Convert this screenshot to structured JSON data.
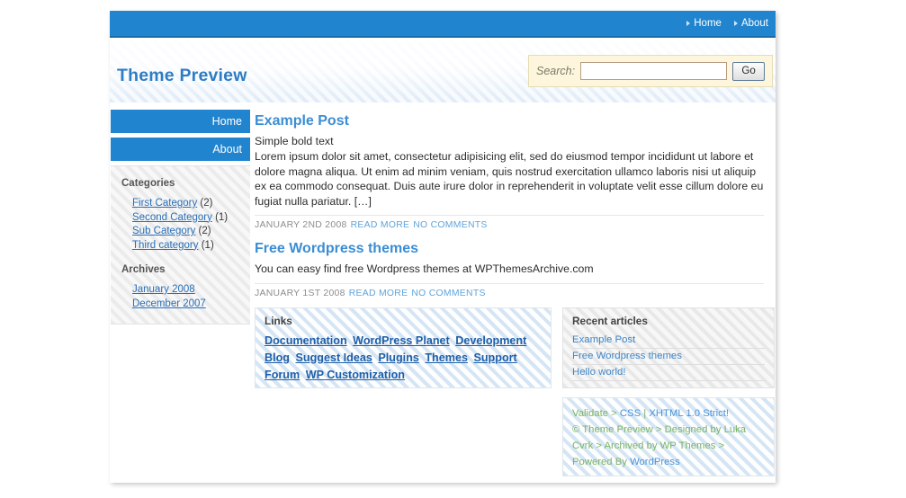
{
  "topnav": {
    "items": [
      {
        "label": "Home"
      },
      {
        "label": "About"
      }
    ]
  },
  "masthead": {
    "site_title": "Theme Preview"
  },
  "search": {
    "label": "Search:",
    "value": "",
    "placeholder": "",
    "button_label": "Go"
  },
  "sidebar": {
    "nav": [
      {
        "label": "Home"
      },
      {
        "label": "About"
      }
    ],
    "categories": {
      "title": "Categories",
      "items": [
        {
          "label": "First Category",
          "count": "(2)"
        },
        {
          "label": "Second Category",
          "count": "(1)"
        },
        {
          "label": "Sub Category",
          "count": "(2)"
        },
        {
          "label": "Third category",
          "count": "(1)"
        }
      ]
    },
    "archives": {
      "title": "Archives",
      "items": [
        {
          "label": "January 2008"
        },
        {
          "label": "December 2007"
        }
      ]
    }
  },
  "posts": [
    {
      "title": "Example Post",
      "lead": "Simple bold text",
      "body": "Lorem ipsum dolor sit amet, consectetur adipisicing elit, sed do eiusmod tempor incididunt ut labore et dolore magna aliqua. Ut enim ad minim veniam, quis nostrud exercitation ullamco laboris nisi ut aliquip ex ea commodo consequat. Duis aute irure dolor in reprehenderit in voluptate velit esse cillum dolore eu fugiat nulla pariatur. […]",
      "date": "JANUARY 2ND 2008",
      "read_more": "READ MORE",
      "comments": "NO COMMENTS"
    },
    {
      "title": "Free Wordpress themes",
      "lead": "",
      "body": "You can easy find free Wordpress themes at WPThemesArchive.com",
      "date": "JANUARY 1ST 2008",
      "read_more": "READ MORE",
      "comments": "NO COMMENTS"
    }
  ],
  "links": {
    "title": "Links",
    "items": [
      {
        "label": "Documentation"
      },
      {
        "label": "WordPress Planet"
      },
      {
        "label": "Development Blog"
      },
      {
        "label": "Suggest Ideas"
      },
      {
        "label": "Plugins"
      },
      {
        "label": "Themes"
      },
      {
        "label": "Support Forum"
      },
      {
        "label": "WP Customization"
      }
    ]
  },
  "recent": {
    "title": "Recent articles",
    "items": [
      {
        "label": "Example Post"
      },
      {
        "label": "Free Wordpress themes"
      },
      {
        "label": "Hello world!"
      }
    ]
  },
  "credits": {
    "validate_label": "Validate",
    "sep1": ">",
    "css_link": "CSS",
    "pipe": "|",
    "xhtml_link": "XHTML 1.0 Strict!",
    "copyright": "© Theme Preview",
    "sep2": ">",
    "designed_by": "Designed by Luka Cvrk",
    "sep3": ">",
    "archived_by": "Archived by WP Themes",
    "sep4": ">",
    "powered_by": "Powered By",
    "wordpress": "WordPress"
  },
  "colors": {
    "brand_blue": "#2184ce",
    "title_blue": "#2e7cc4",
    "link_blue": "#2a6fb8",
    "search_bg": "#fdf6dd",
    "credit_green": "#79b365"
  }
}
